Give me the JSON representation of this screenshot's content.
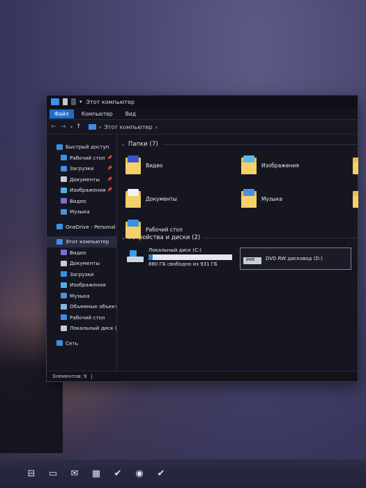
{
  "window": {
    "title": "Этот компьютер",
    "ribbon_tabs": [
      "Файл",
      "Компьютер",
      "Вид"
    ],
    "address": "Этот компьютер"
  },
  "sidebar": {
    "items": [
      {
        "label": "Быстрый доступ",
        "icon": "star-icon",
        "color": "#3c8ee6"
      },
      {
        "label": "Рабочий стол",
        "icon": "desktop-icon",
        "color": "#3c8ee6",
        "pin": "📌"
      },
      {
        "label": "Загрузки",
        "icon": "downloads-icon",
        "color": "#3c8ee6",
        "pin": "📌"
      },
      {
        "label": "Документы",
        "icon": "documents-icon",
        "color": "#c9ced6",
        "pin": "📌"
      },
      {
        "label": "Изображения",
        "icon": "pictures-icon",
        "color": "#4fb0e6",
        "pin": "📌"
      },
      {
        "label": "Видео",
        "icon": "video-icon",
        "color": "#7a6fd0"
      },
      {
        "label": "Музыка",
        "icon": "music-icon",
        "color": "#4f8ee0"
      },
      {
        "label": "OneDrive - Personal",
        "icon": "onedrive-icon",
        "color": "#3c8ee6"
      },
      {
        "label": "Этот компьютер",
        "icon": "this-pc-icon",
        "color": "#3c8ee6"
      },
      {
        "label": "Видео",
        "icon": "video-icon",
        "color": "#7a6fd0"
      },
      {
        "label": "Документы",
        "icon": "documents-icon",
        "color": "#c9ced6"
      },
      {
        "label": "Загрузки",
        "icon": "downloads-icon",
        "color": "#3c8ee6"
      },
      {
        "label": "Изображения",
        "icon": "pictures-icon",
        "color": "#4fb0e6"
      },
      {
        "label": "Музыка",
        "icon": "music-icon",
        "color": "#4f8ee0"
      },
      {
        "label": "Объемные объекты",
        "icon": "3d-objects-icon",
        "color": "#7fb6e8"
      },
      {
        "label": "Рабочий стол",
        "icon": "desktop-icon",
        "color": "#3c8ee6"
      },
      {
        "label": "Локальный диск (C:)",
        "icon": "drive-icon",
        "color": "#c9ced6"
      },
      {
        "label": "Сеть",
        "icon": "network-icon",
        "color": "#3c8ee6"
      }
    ]
  },
  "folders_group": {
    "title": "Папки (7)",
    "folders": [
      {
        "name": "Видео",
        "icon": "video-folder-icon",
        "accent": "#3a55c9"
      },
      {
        "name": "Документы",
        "icon": "documents-folder-icon",
        "accent": "#f2f2f2"
      },
      {
        "name": "Изображения",
        "icon": "pictures-folder-icon",
        "accent": "#5fb7e8"
      },
      {
        "name": "Музыка",
        "icon": "music-folder-icon",
        "accent": "#4f8ee0"
      },
      {
        "name": "Рабочий стол",
        "icon": "desktop-folder-icon",
        "accent": "#3c8ee6"
      }
    ]
  },
  "drives_group": {
    "title": "Устройства и диски (2)",
    "drives": [
      {
        "name": "Локальный диск (C:)",
        "free_text": "880 ГБ свободно из 931 ГБ",
        "used_fraction": 0.054
      },
      {
        "name": "DVD RW дисковод (D:)",
        "badge": "DVD"
      }
    ]
  },
  "status": {
    "items": "Элементов: 9"
  },
  "taskbar": {
    "buttons": [
      {
        "icon": "task-view-icon",
        "glyph": "⊟"
      },
      {
        "icon": "file-explorer-icon",
        "glyph": "▭"
      },
      {
        "icon": "mail-icon",
        "glyph": "✉"
      },
      {
        "icon": "store-icon",
        "glyph": "▦"
      },
      {
        "icon": "checkmark-app-icon",
        "glyph": "✔"
      },
      {
        "icon": "chrome-icon",
        "glyph": "◉"
      },
      {
        "icon": "checkmark-app-icon",
        "glyph": "✔"
      }
    ]
  },
  "colors": {
    "accent": "#1e6fc9",
    "folder_yellow": "#f4d169",
    "drive_bar": "#2a84d8"
  }
}
